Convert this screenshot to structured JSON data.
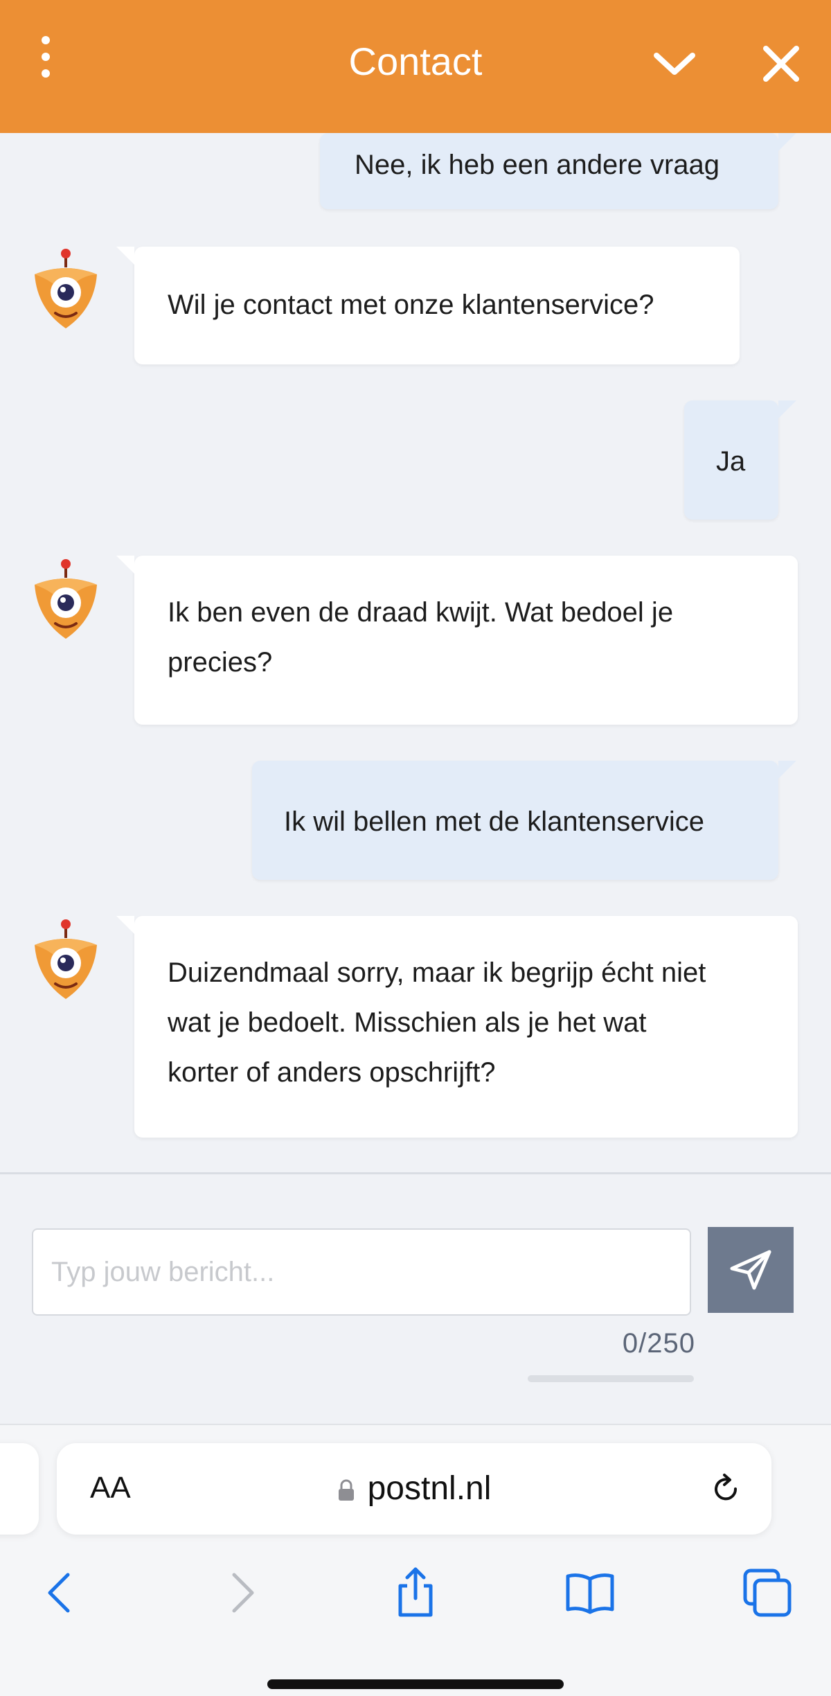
{
  "header": {
    "title": "Contact",
    "menu_icon": "vertical-dots-icon",
    "collapse_icon": "chevron-down-icon",
    "close_icon": "close-icon",
    "color": "#ec8f34"
  },
  "messages": [
    {
      "from": "user",
      "lines": [
        "Nee, ik heb een andere vraag"
      ]
    },
    {
      "from": "bot",
      "lines": [
        "Wil je contact met onze klantenservice?"
      ]
    },
    {
      "from": "user",
      "lines": [
        "Ja"
      ]
    },
    {
      "from": "bot",
      "lines": [
        "Ik ben even de draad kwijt. Wat bedoel je",
        "precies?"
      ]
    },
    {
      "from": "user",
      "lines": [
        "Ik wil bellen met de klantenservice"
      ]
    },
    {
      "from": "bot",
      "lines": [
        "Duizendmaal sorry, maar ik begrijp écht niet",
        "wat je bedoelt. Misschien als je het wat",
        "korter of anders opschrijft?"
      ]
    }
  ],
  "composer": {
    "placeholder": "Typ jouw bericht...",
    "value": "",
    "counter": "0/250",
    "send_icon": "paper-plane-icon",
    "send_color": "#6e7a8e"
  },
  "browser": {
    "text_size_label": "AA",
    "url": "postnl.nl",
    "lock_icon": "lock-icon",
    "reload_icon": "reload-icon",
    "toolbar": [
      "back-icon",
      "forward-icon",
      "share-icon",
      "bookmarks-icon",
      "tabs-icon"
    ]
  }
}
